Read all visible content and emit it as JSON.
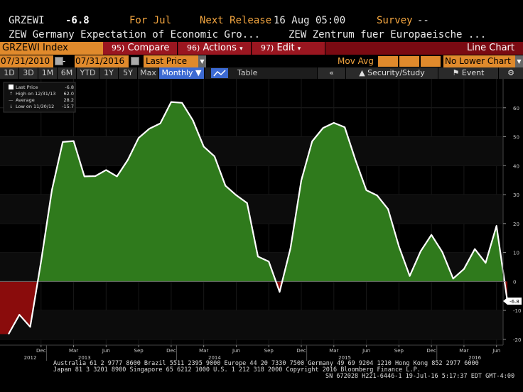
{
  "header": {
    "ticker": "GRZEWI",
    "last_value": "-6.8",
    "for_period": "For Jul",
    "next_release_label": "Next Release",
    "next_release_value": "16 Aug 05:00",
    "survey_label": "Survey",
    "survey_value": "--",
    "description_left": "ZEW Germany Expectation of Economic Gro...",
    "description_right": "ZEW Zentrum fuer Europaeische ..."
  },
  "toolbar": {
    "index_label": "GRZEWI Index",
    "compare_num": "95)",
    "compare_label": "Compare",
    "actions_num": "96)",
    "actions_label": "Actions",
    "edit_num": "97)",
    "edit_label": "Edit",
    "chart_type": "Line Chart"
  },
  "range": {
    "start_date": "07/31/2010",
    "dash": "-",
    "end_date": "07/31/2016",
    "field": "Last Price",
    "mov_avg_label": "Mov Avg",
    "lower_chart": "No Lower Chart"
  },
  "periods": {
    "items": [
      "1D",
      "3D",
      "1M",
      "6M",
      "YTD",
      "1Y",
      "5Y",
      "Max"
    ],
    "frequency": "Monthly",
    "table_label": "Table",
    "back_label": "«",
    "security_study": "Security/Study",
    "event": "Event",
    "gear": "⚙"
  },
  "legend": {
    "last_price": "Last Price",
    "last_price_value": "-6.8",
    "high": "High on 12/31/13",
    "high_value": "62.0",
    "average": "Average",
    "average_value": "28.2",
    "low": "Low on 11/30/12",
    "low_value": "-15.7"
  },
  "colors": {
    "positive_fill": "#2f7a1c",
    "negative_fill": "#8a0c0c",
    "line": "#ffffff",
    "accent_orange": "#e08a2c"
  },
  "chart_data": {
    "type": "area",
    "ylim": [
      -22,
      70
    ],
    "yticks": [
      -20,
      -10,
      0,
      10,
      20,
      30,
      40,
      50,
      60
    ],
    "y_tick_labels": [
      "-20",
      "-10",
      "0",
      "10",
      "20",
      "30",
      "40",
      "50",
      "60"
    ],
    "x_tick_labels": [
      "Dec",
      "Mar",
      "Jun",
      "Sep",
      "Dec",
      "Mar",
      "Jun",
      "Sep",
      "Dec",
      "Mar",
      "Jun",
      "Sep",
      "Dec",
      "Mar",
      "Jun"
    ],
    "x_tick_months": [
      "2012-12",
      "2013-03",
      "2013-06",
      "2013-09",
      "2013-12",
      "2014-03",
      "2014-06",
      "2014-09",
      "2014-12",
      "2015-03",
      "2015-06",
      "2015-09",
      "2015-12",
      "2016-03",
      "2016-06"
    ],
    "year_labels": [
      {
        "label": "2012",
        "month": "2012-11"
      },
      {
        "label": "2013",
        "month": "2013-04"
      },
      {
        "label": "2014",
        "month": "2014-04"
      },
      {
        "label": "2015",
        "month": "2015-04"
      },
      {
        "label": "2016",
        "month": "2016-04"
      }
    ],
    "year_separators": [
      "2013-01",
      "2014-01",
      "2015-01",
      "2016-01"
    ],
    "last_label": "-6.8",
    "grid": true,
    "series": [
      {
        "dates": [
          "2012-09",
          "2012-10",
          "2012-11",
          "2012-12",
          "2013-01",
          "2013-02",
          "2013-03",
          "2013-04",
          "2013-05",
          "2013-06",
          "2013-07",
          "2013-08",
          "2013-09",
          "2013-10",
          "2013-11",
          "2013-12",
          "2014-01",
          "2014-02",
          "2014-03",
          "2014-04",
          "2014-05",
          "2014-06",
          "2014-07",
          "2014-08",
          "2014-09",
          "2014-10",
          "2014-11",
          "2014-12",
          "2015-01",
          "2015-02",
          "2015-03",
          "2015-04",
          "2015-05",
          "2015-06",
          "2015-07",
          "2015-08",
          "2015-09",
          "2015-10",
          "2015-11",
          "2015-12",
          "2016-01",
          "2016-02",
          "2016-03",
          "2016-04",
          "2016-05",
          "2016-06",
          "2016-07"
        ],
        "values": [
          -18.2,
          -11.5,
          -15.7,
          6.9,
          31.5,
          48.2,
          48.5,
          36.3,
          36.4,
          38.5,
          36.3,
          42.0,
          49.6,
          52.8,
          54.6,
          62.0,
          61.7,
          55.7,
          46.6,
          43.2,
          33.1,
          29.8,
          27.1,
          8.6,
          6.9,
          -3.6,
          11.5,
          34.9,
          48.4,
          53.0,
          54.8,
          53.3,
          41.9,
          31.5,
          29.7,
          25.0,
          12.1,
          1.9,
          10.4,
          16.1,
          10.2,
          1.0,
          4.3,
          11.2,
          6.4,
          19.2,
          -6.8
        ]
      }
    ]
  },
  "footer": {
    "line1": "Australia 61 2 9777 8600 Brazil 5511 2395 9000 Europe 44 20 7330 7500 Germany 49 69 9204 1210 Hong Kong 852 2977 6000",
    "line2": "Japan 81 3 3201 8900         Singapore 65 6212 1000         U.S. 1 212 318 2000         Copyright 2016 Bloomberg Finance L.P.",
    "line3": "SN 672028 H221-6446-1 19-Jul-16  5:17:37 EDT  GMT-4:00"
  }
}
